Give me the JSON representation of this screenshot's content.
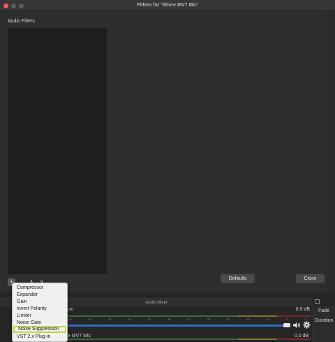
{
  "window": {
    "title": "Filters for 'Shure MV7 Mic'"
  },
  "filters_panel": {
    "label": "Audio Filters"
  },
  "buttons": {
    "add": "+",
    "up": "∧",
    "down": "∨",
    "defaults": "Defaults",
    "close": "Close"
  },
  "add_menu": {
    "items": [
      "Compressor",
      "Expander",
      "Gain",
      "Invert Polarity",
      "Limiter",
      "Noise Gate",
      "Noise Suppression",
      "VST 2.x Plug-in"
    ],
    "highlighted": "Noise Suppression"
  },
  "mixer": {
    "title": "Audio Mixer",
    "row1": {
      "name": "ux",
      "level": "0.0 dB"
    },
    "row2": {
      "name": "e MV7 Mic",
      "level": "0.0 dB"
    },
    "ticks": [
      "-60",
      "-55",
      "-50",
      "-45",
      "-40",
      "-35",
      "-30",
      "-25",
      "-20",
      "-15",
      "-10",
      "-5",
      "0"
    ]
  },
  "side_panel": {
    "fade": "Fade",
    "duration": "Duration"
  },
  "colors": {
    "close_light": "#ec5f57",
    "slider": "#2f6fc4",
    "highlight_border": "#c9d43c"
  }
}
